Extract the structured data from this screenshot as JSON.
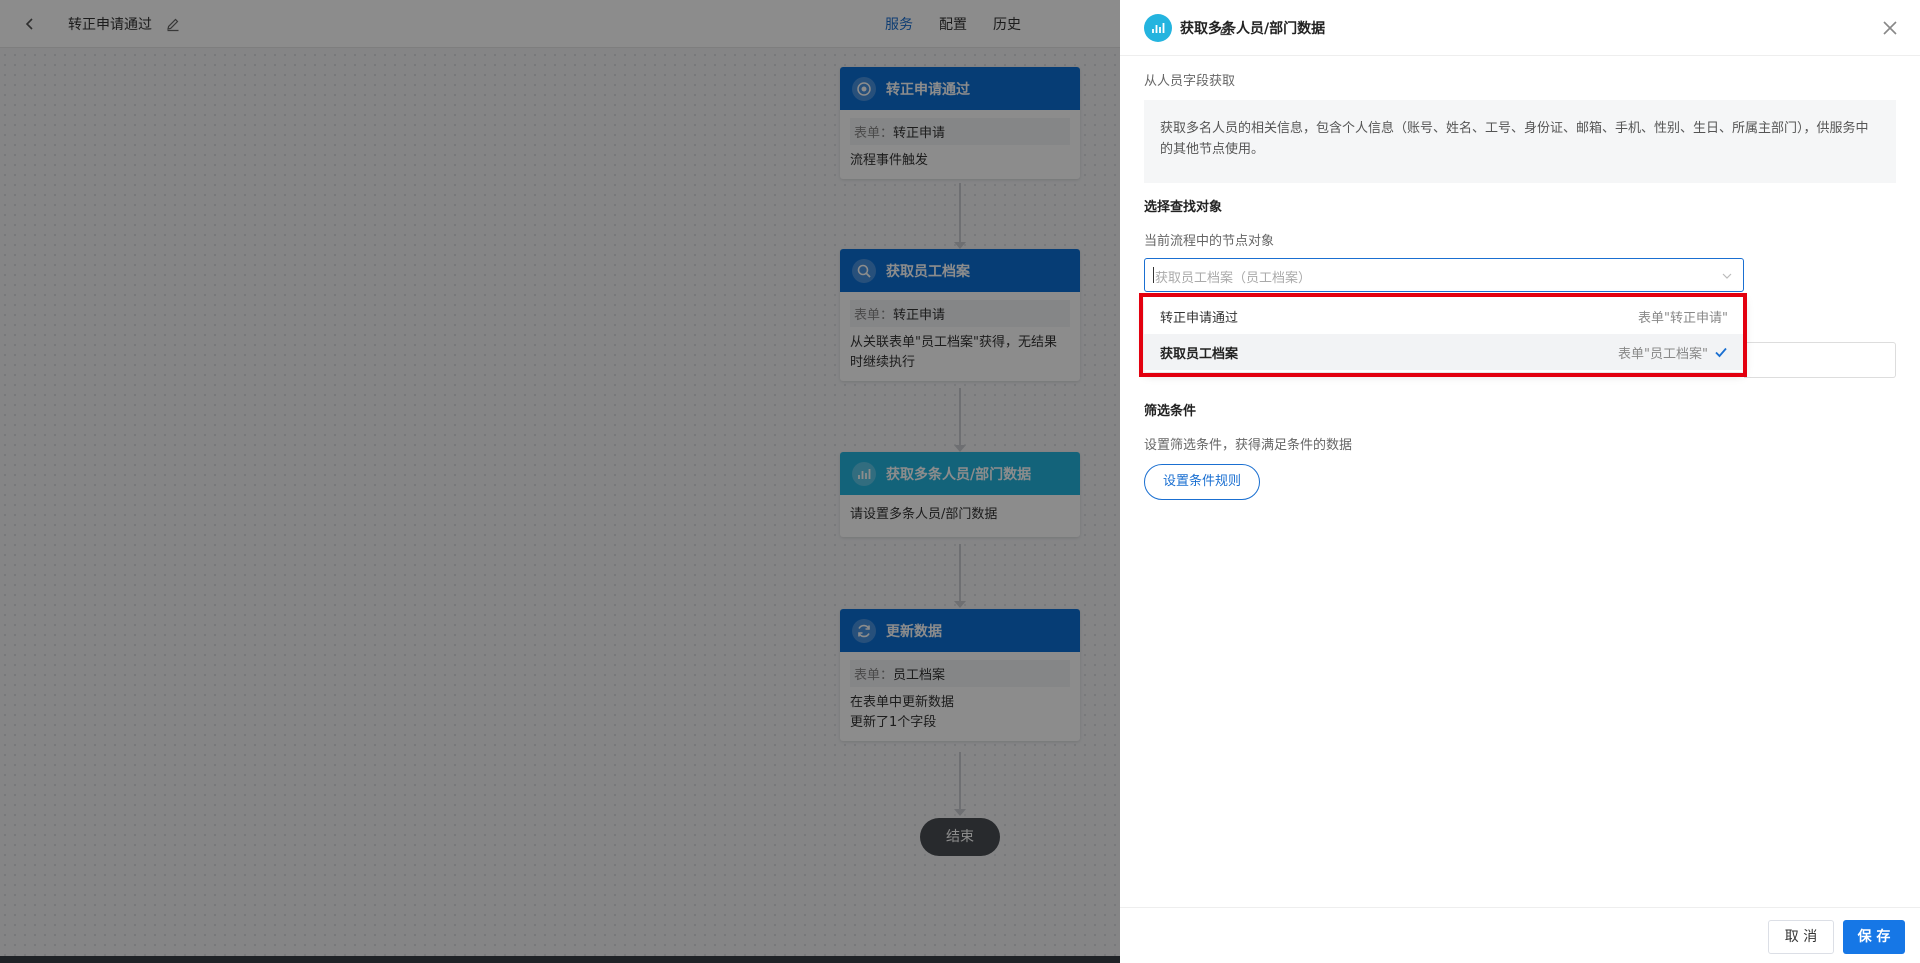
{
  "topbar": {
    "back_label": "‹",
    "flow_title": "转正申请通过",
    "tabs": [
      {
        "label": "服务",
        "active": true
      },
      {
        "label": "配置",
        "active": false
      },
      {
        "label": "历史",
        "active": false
      }
    ]
  },
  "flow": {
    "nodes": [
      {
        "title": "转正申请通过",
        "icon": "target-icon",
        "chip_key": "表单：",
        "chip_value": "转正申请",
        "lines": [
          "流程事件触发"
        ]
      },
      {
        "title": "获取员工档案",
        "icon": "search-icon",
        "chip_key": "表单：",
        "chip_value": "转正申请",
        "lines": [
          "从关联表单\"员工档案\"获得，无结果",
          "时继续执行"
        ]
      },
      {
        "title": "获取多条人员/部门数据",
        "icon": "bar-chart-icon",
        "lines": [
          "请设置多条人员/部门数据"
        ]
      },
      {
        "title": "更新数据",
        "icon": "refresh-icon",
        "chip_key": "表单：",
        "chip_value": "员工档案",
        "lines": [
          "在表单中更新数据",
          "更新了1个字段"
        ]
      }
    ],
    "end_label": "结束"
  },
  "panel": {
    "title": "获取多条人员/部门数据",
    "source_label": "从人员字段获取",
    "description": "获取多名人员的相关信息，包含个人信息（账号、姓名、工号、身份证、邮箱、手机、性别、生日、所属主部门），供服务中的其他节点使用。",
    "target_section_title": "选择查找对象",
    "target_hint": "当前流程中的节点对象",
    "select_placeholder": "获取员工档案（员工档案）",
    "options": [
      {
        "label": "转正申请通过",
        "tag": "表单\"转正申请\"",
        "selected": false
      },
      {
        "label": "获取员工档案",
        "tag": "表单\"员工档案\"",
        "selected": true
      }
    ],
    "filter_section_title": "筛选条件",
    "filter_hint": "设置筛选条件，获得满足条件的数据",
    "rule_button": "设置条件规则",
    "cancel_label": "取 消",
    "save_label": "保 存"
  },
  "colors": {
    "accent": "#1a6fd1",
    "node_blue": "#0b6fd6",
    "node_cyan": "#24b4df",
    "highlight": "#e3000f"
  }
}
